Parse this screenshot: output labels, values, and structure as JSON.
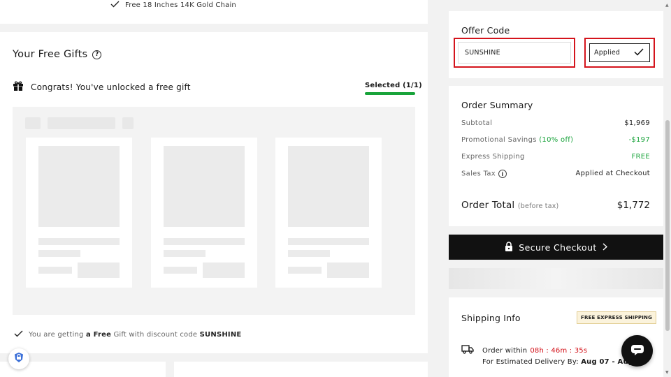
{
  "top_line": {
    "text": "Free 18 Inches 14K Gold Chain"
  },
  "gifts": {
    "title": "Your Free Gifts",
    "congrats": "Congrats! You've unlocked a free gift",
    "selected": "Selected (1/1)",
    "getting_prefix": "You are getting ",
    "getting_free": "a Free",
    "getting_mid": " Gift with discount code ",
    "getting_code": "SUNSHINE"
  },
  "offer": {
    "title": "Offer Code",
    "code": "SUNSHINE",
    "applied_label": "Applied"
  },
  "summary": {
    "title": "Order Summary",
    "rows": [
      {
        "label": "Subtotal",
        "value": "$1,969"
      },
      {
        "label": "Promotional Savings",
        "extra": "(10% off)",
        "value": "-$197"
      },
      {
        "label": "Express Shipping",
        "value": "FREE"
      },
      {
        "label": "Sales Tax",
        "value": "Applied at Checkout"
      }
    ],
    "total_label": "Order Total",
    "total_note": "(before tax)",
    "total_value": "$1,772"
  },
  "checkout": {
    "label": "Secure Checkout"
  },
  "shipping": {
    "title": "Shipping Info",
    "badge": "FREE EXPRESS SHIPPING",
    "order_within": "Order within",
    "countdown": "08h : 46m : 35s",
    "delivery_label": "For Estimated Delivery By:",
    "delivery_value": "Aug 07 - Aug"
  },
  "colors": {
    "accent_green": "#18a33a",
    "highlight_red": "#d4141c",
    "button_black": "#111111"
  }
}
